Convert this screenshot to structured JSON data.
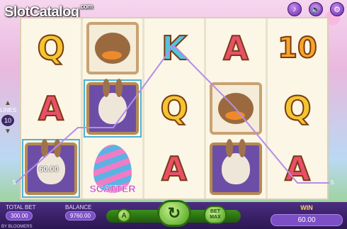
{
  "brand": {
    "logo_slot": "Slot",
    "logo_catalog": "Catalog",
    "logo_dotcom": ".com"
  },
  "top_icons": [
    "music-icon",
    "sound-icon",
    "settings-icon"
  ],
  "reels": [
    [
      "Q",
      "A",
      "bunny-60.00"
    ],
    [
      "duck",
      "bunny",
      "egg-scatter"
    ],
    [
      "K",
      "Q",
      "A"
    ],
    [
      "A",
      "duck",
      "bunny"
    ],
    [
      "10",
      "Q",
      "A"
    ]
  ],
  "symbol_labels": {
    "scatter": "SCATTER",
    "win_on_symbol": "60.00"
  },
  "lines": {
    "label": "LINES",
    "value": "10"
  },
  "markers": {
    "left": "5",
    "right": "5"
  },
  "bottom": {
    "total_bet_label": "TOTAL BET",
    "total_bet": "300.00",
    "balance_label": "BALANCE",
    "balance": "9760.00",
    "auto_label": "A",
    "spin_glyph": "↻",
    "betmax_line1": "BET",
    "betmax_line2": "MAX",
    "win_label": "WIN",
    "win_value": "60.00",
    "footer_name": "BY BLOOMERS"
  },
  "colors": {
    "bar": "#3d2368",
    "accent_green": "#46a01c",
    "win_gold": "#ffd54a"
  }
}
